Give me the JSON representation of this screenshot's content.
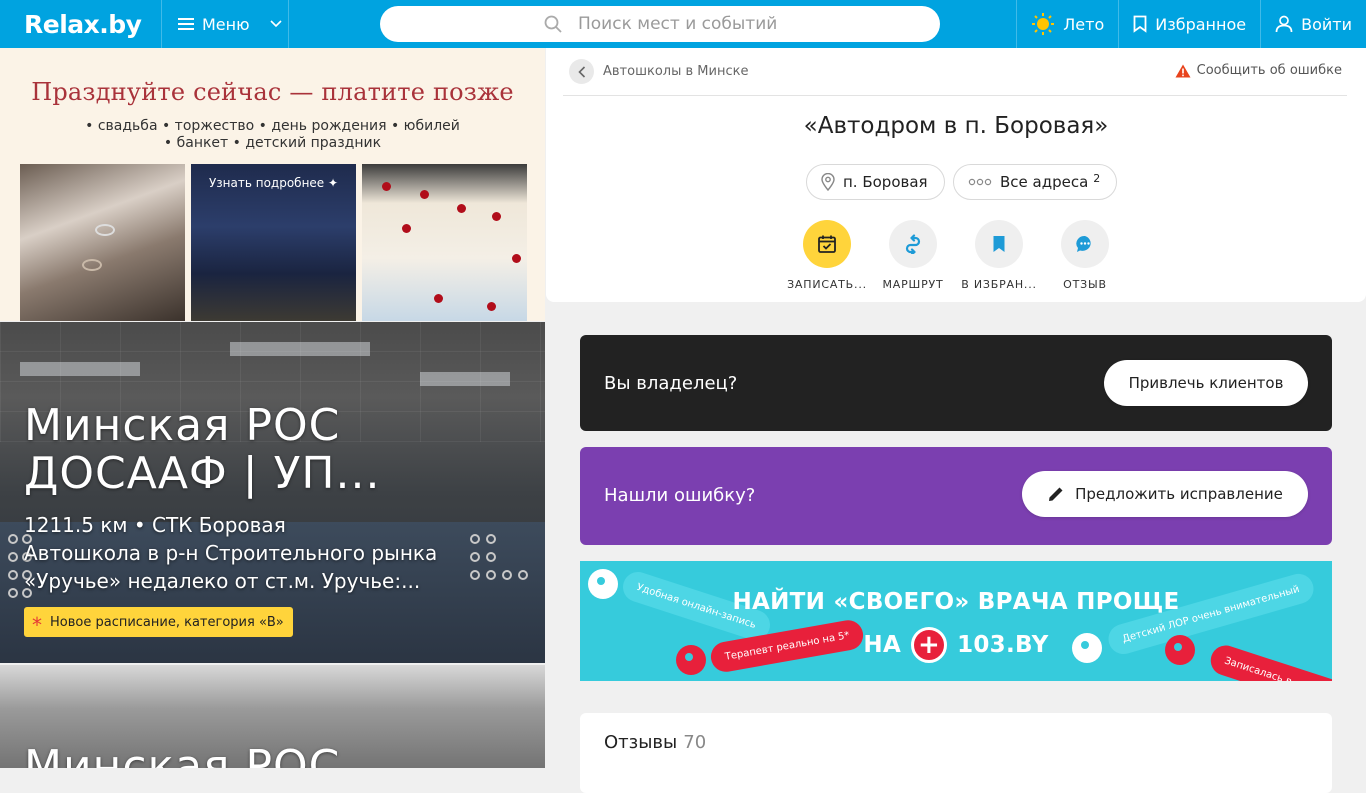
{
  "header": {
    "logo": "Relax.by",
    "menu_label": "Меню",
    "search_placeholder": "Поиск мест и событий",
    "season_label": "Лето",
    "favorites_label": "Избранное",
    "login_label": "Войти",
    "accent_color": "#00a3e0"
  },
  "ad": {
    "title": "Празднуйте сейчас — платите позже",
    "line1": "• свадьба • торжество • день рождения • юбилей",
    "line2": "• банкет • детский праздник",
    "button_label": "Узнать подробнее ✦"
  },
  "cards": [
    {
      "title": "Минская РОС ДОСААФ | УП...",
      "distance": "1211.5 км • СТК Боровая",
      "description": "Автошкола в р-н Строительного рынка «Уручье» недалеко от ст.м. Уручье:...",
      "badge": "Новое расписание, категория «В»"
    },
    {
      "title": "Минская РОС"
    }
  ],
  "place": {
    "breadcrumb": "Автошколы в Минске",
    "report_label": "Сообщить об ошибке",
    "title": "«Автодром в п. Боровая»",
    "location_chip": "п. Боровая",
    "addresses_chip": "Все адреса",
    "addresses_count": "2",
    "actions": [
      {
        "label": "ЗАПИСАТЬ...",
        "icon": "calendar-check-icon"
      },
      {
        "label": "МАРШРУТ",
        "icon": "route-icon"
      },
      {
        "label": "В ИЗБРАН...",
        "icon": "bookmark-icon"
      },
      {
        "label": "ОТЗЫВ",
        "icon": "chat-icon"
      }
    ]
  },
  "owner_block": {
    "text": "Вы владелец?",
    "button": "Привлечь клиентов"
  },
  "fix_block": {
    "text": "Нашли ошибку?",
    "button": "Предложить исправление"
  },
  "banner": {
    "title": "НАЙТИ «СВОЕГО» ВРАЧА ПРОЩЕ",
    "sub_prefix": "НА",
    "sub_brand": "103.BY",
    "tags": [
      "Удобная онлайн-запись",
      "Терапевт реально на 5*",
      "Детский ЛОР очень внимательный",
      "Записалась в один кл"
    ]
  },
  "reviews": {
    "title": "Отзывы",
    "count": "70"
  },
  "colors": {
    "owner_bg": "#222222",
    "fix_bg": "#7b3fb0",
    "banner_bg": "#36cbdc",
    "booking_yellow": "#ffd43b",
    "route_blue": "#1e9bd7"
  }
}
